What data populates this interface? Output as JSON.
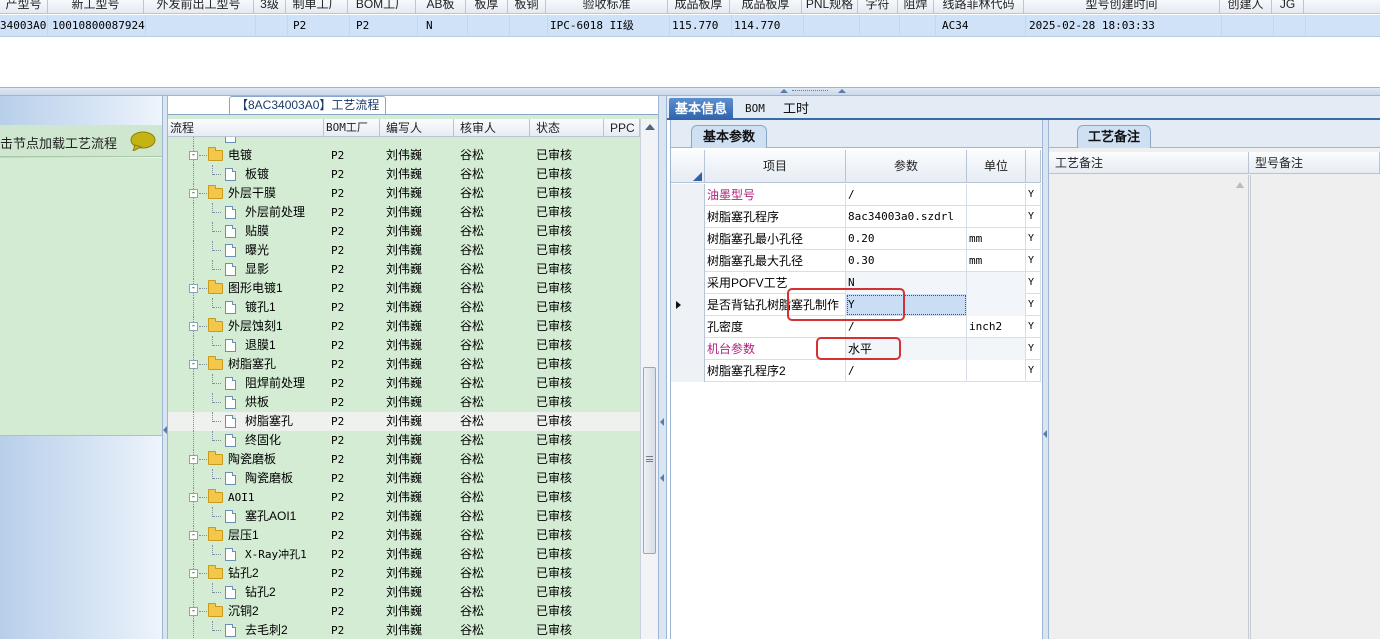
{
  "top_grid": {
    "headers": [
      "产型号",
      "新工型号",
      "外发前出工型号",
      "3级",
      "制单工厂",
      "BOM工厂",
      "AB板",
      "板厚",
      "板铜",
      "验收标准",
      "成品板厚",
      "成品板厚",
      "PNL规格",
      "字符",
      "阻焊",
      "线路菲林代码",
      "型号创建时间",
      "创建人",
      "JG"
    ],
    "row": {
      "code": "34003A0",
      "material_no": "10010800087924",
      "factory": "P2",
      "bom_factory": "P2",
      "ab": "N",
      "standard": "IPC-6018 II级",
      "thickness1": "115.770",
      "thickness2": "114.770",
      "film": "AC34",
      "created_at": "2025-02-28 18:03:33"
    }
  },
  "left_panel": {
    "tip": "击节点加载工艺流程",
    "bubble_icon": "speech-bubble-icon"
  },
  "tree": {
    "title": "【8AC34003A0】工艺流程",
    "columns": [
      "流程",
      "BOM工厂",
      "编写人",
      "核审人",
      "状态",
      "PPC"
    ],
    "rows": [
      {
        "name": "",
        "level": 2,
        "type": "doc",
        "factory": "",
        "writer": "",
        "reviewer": "",
        "status": ""
      },
      {
        "name": "电镀",
        "level": 1,
        "type": "folder",
        "factory": "P2",
        "writer": "刘伟巍",
        "reviewer": "谷松",
        "status": "已审核"
      },
      {
        "name": "板镀",
        "level": 2,
        "type": "doc",
        "factory": "P2",
        "writer": "刘伟巍",
        "reviewer": "谷松",
        "status": "已审核"
      },
      {
        "name": "外层干膜",
        "level": 1,
        "type": "folder",
        "factory": "P2",
        "writer": "刘伟巍",
        "reviewer": "谷松",
        "status": "已审核"
      },
      {
        "name": "外层前处理",
        "level": 2,
        "type": "doc",
        "factory": "P2",
        "writer": "刘伟巍",
        "reviewer": "谷松",
        "status": "已审核"
      },
      {
        "name": "贴膜",
        "level": 2,
        "type": "doc",
        "factory": "P2",
        "writer": "刘伟巍",
        "reviewer": "谷松",
        "status": "已审核"
      },
      {
        "name": "曝光",
        "level": 2,
        "type": "doc",
        "factory": "P2",
        "writer": "刘伟巍",
        "reviewer": "谷松",
        "status": "已审核"
      },
      {
        "name": "显影",
        "level": 2,
        "type": "doc",
        "factory": "P2",
        "writer": "刘伟巍",
        "reviewer": "谷松",
        "status": "已审核"
      },
      {
        "name": "图形电镀1",
        "level": 1,
        "type": "folder",
        "factory": "P2",
        "writer": "刘伟巍",
        "reviewer": "谷松",
        "status": "已审核"
      },
      {
        "name": "镀孔1",
        "level": 2,
        "type": "doc",
        "factory": "P2",
        "writer": "刘伟巍",
        "reviewer": "谷松",
        "status": "已审核"
      },
      {
        "name": "外层蚀刻1",
        "level": 1,
        "type": "folder",
        "factory": "P2",
        "writer": "刘伟巍",
        "reviewer": "谷松",
        "status": "已审核"
      },
      {
        "name": "退膜1",
        "level": 2,
        "type": "doc",
        "factory": "P2",
        "writer": "刘伟巍",
        "reviewer": "谷松",
        "status": "已审核"
      },
      {
        "name": "树脂塞孔",
        "level": 1,
        "type": "folder",
        "factory": "P2",
        "writer": "刘伟巍",
        "reviewer": "谷松",
        "status": "已审核"
      },
      {
        "name": "阻焊前处理",
        "level": 2,
        "type": "doc",
        "factory": "P2",
        "writer": "刘伟巍",
        "reviewer": "谷松",
        "status": "已审核"
      },
      {
        "name": "烘板",
        "level": 2,
        "type": "doc",
        "factory": "P2",
        "writer": "刘伟巍",
        "reviewer": "谷松",
        "status": "已审核"
      },
      {
        "name": "树脂塞孔",
        "level": 2,
        "type": "doc",
        "factory": "P2",
        "writer": "刘伟巍",
        "reviewer": "谷松",
        "status": "已审核",
        "selected": true
      },
      {
        "name": "终固化",
        "level": 2,
        "type": "doc",
        "factory": "P2",
        "writer": "刘伟巍",
        "reviewer": "谷松",
        "status": "已审核"
      },
      {
        "name": "陶瓷磨板",
        "level": 1,
        "type": "folder",
        "factory": "P2",
        "writer": "刘伟巍",
        "reviewer": "谷松",
        "status": "已审核"
      },
      {
        "name": "陶瓷磨板",
        "level": 2,
        "type": "doc",
        "factory": "P2",
        "writer": "刘伟巍",
        "reviewer": "谷松",
        "status": "已审核"
      },
      {
        "name": "AOI1",
        "level": 1,
        "type": "folder",
        "factory": "P2",
        "writer": "刘伟巍",
        "reviewer": "谷松",
        "status": "已审核"
      },
      {
        "name": "塞孔AOI1",
        "level": 2,
        "type": "doc",
        "factory": "P2",
        "writer": "刘伟巍",
        "reviewer": "谷松",
        "status": "已审核"
      },
      {
        "name": "层压1",
        "level": 1,
        "type": "folder",
        "factory": "P2",
        "writer": "刘伟巍",
        "reviewer": "谷松",
        "status": "已审核"
      },
      {
        "name": "X-Ray冲孔1",
        "level": 2,
        "type": "doc",
        "factory": "P2",
        "writer": "刘伟巍",
        "reviewer": "谷松",
        "status": "已审核"
      },
      {
        "name": "钻孔2",
        "level": 1,
        "type": "folder",
        "factory": "P2",
        "writer": "刘伟巍",
        "reviewer": "谷松",
        "status": "已审核"
      },
      {
        "name": "钻孔2",
        "level": 2,
        "type": "doc",
        "factory": "P2",
        "writer": "刘伟巍",
        "reviewer": "谷松",
        "status": "已审核"
      },
      {
        "name": "沉铜2",
        "level": 1,
        "type": "folder",
        "factory": "P2",
        "writer": "刘伟巍",
        "reviewer": "谷松",
        "status": "已审核"
      },
      {
        "name": "去毛刺2",
        "level": 2,
        "type": "doc",
        "factory": "P2",
        "writer": "刘伟巍",
        "reviewer": "谷松",
        "status": "已审核"
      },
      {
        "name": "",
        "level": 2,
        "type": "doc",
        "factory": "",
        "writer": "",
        "reviewer": "",
        "status": ""
      }
    ]
  },
  "right": {
    "tabs": [
      "基本信息",
      "BOM",
      "工时"
    ],
    "params_tab": "基本参数",
    "notes_tab": "工艺备注",
    "param_columns": [
      "项目",
      "参数",
      "单位"
    ],
    "params": [
      {
        "item": "油墨型号",
        "value": "/",
        "unit": "",
        "flag": "Y",
        "pink": true
      },
      {
        "item": "树脂塞孔程序",
        "value": "8ac34003a0.szdrl",
        "unit": "",
        "flag": "Y"
      },
      {
        "item": "树脂塞孔最小孔径",
        "value": "0.20",
        "unit": "mm",
        "flag": "Y"
      },
      {
        "item": "树脂塞孔最大孔径",
        "value": "0.30",
        "unit": "mm",
        "flag": "Y"
      },
      {
        "item": "采用POFV工艺",
        "value": "N",
        "unit": "",
        "flag": "Y",
        "shaded": true
      },
      {
        "item": "是否背钻孔树脂塞孔制作",
        "value": "Y",
        "unit": "",
        "flag": "Y",
        "current": true
      },
      {
        "item": "孔密度",
        "value": "/",
        "unit": "inch2",
        "flag": "Y"
      },
      {
        "item": "机台参数",
        "value": "水平",
        "unit": "",
        "flag": "Y",
        "pink": true,
        "shaded": true
      },
      {
        "item": "树脂塞孔程序2",
        "value": "/",
        "unit": "",
        "flag": "Y"
      }
    ],
    "notes_columns": [
      "工艺备注",
      "型号备注"
    ]
  },
  "colors": {
    "tree_bg": "#d4ecd4",
    "selection_blue": "#cfe2f7",
    "tab_active": "#2f62a8",
    "annotation_red": "#d33232",
    "pink_label": "#b0207a"
  }
}
